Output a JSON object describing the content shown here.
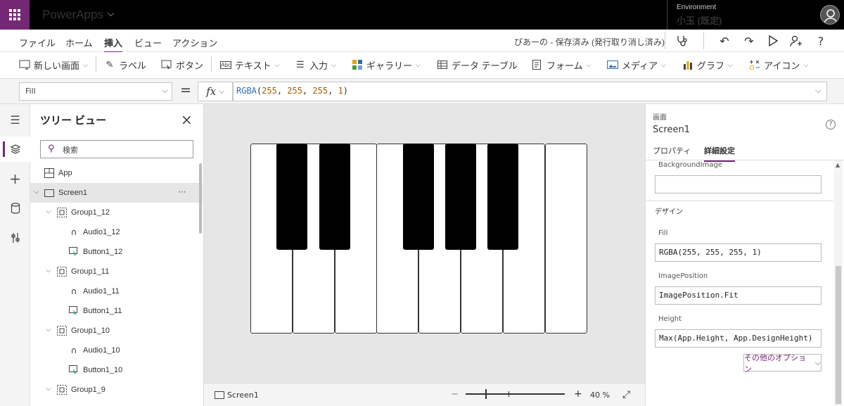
{
  "app": {
    "name": "PowerApps"
  },
  "env": {
    "label": "Environment",
    "name": "小玉 (既定)"
  },
  "menu": {
    "items": [
      "ファイル",
      "ホーム",
      "挿入",
      "ビュー",
      "アクション"
    ],
    "status": "ぴあーの - 保存済み (発行取り消し済み)"
  },
  "ribbon": {
    "items": [
      "新しい画面",
      "ラベル",
      "ボタン",
      "テキスト",
      "入力",
      "ギャラリー",
      "データ テーブル",
      "フォーム",
      "メディア",
      "グラフ",
      "アイコン"
    ]
  },
  "formula": {
    "property": "Fill",
    "fx": "fx",
    "fn": "RGBA",
    "args": [
      "255",
      "255",
      "255",
      "1"
    ]
  },
  "tree": {
    "title": "ツリー ビュー",
    "search_placeholder": "検索",
    "rows": [
      "App",
      "Screen1",
      "Group1_12",
      "Audio1_12",
      "Button1_12",
      "Group1_11",
      "Audio1_11",
      "Button1_11",
      "Group1_10",
      "Audio1_10",
      "Button1_10",
      "Group1_9"
    ],
    "more": "···"
  },
  "canvas": {
    "screen": "Screen1",
    "zoom_minus": "−",
    "zoom_plus": "+",
    "zoom": "40 %"
  },
  "props": {
    "kind": "画面",
    "name": "Screen1",
    "tab_props": "プロパティ",
    "tab_adv": "詳細設定",
    "bg_label": "BackgroundImage",
    "bg_value": "",
    "design": "デザイン",
    "fill_label": "Fill",
    "fill_value": "RGBA(255, 255, 255, 1)",
    "imgpos_label": "ImagePosition",
    "imgpos_value": "ImagePosition.Fit",
    "height_label": "Height",
    "height_value": "Max(App.Height, App.DesignHeight)",
    "more": "その他のオプション"
  },
  "colors": {
    "brand": "#742774",
    "topbar": "#000000"
  }
}
